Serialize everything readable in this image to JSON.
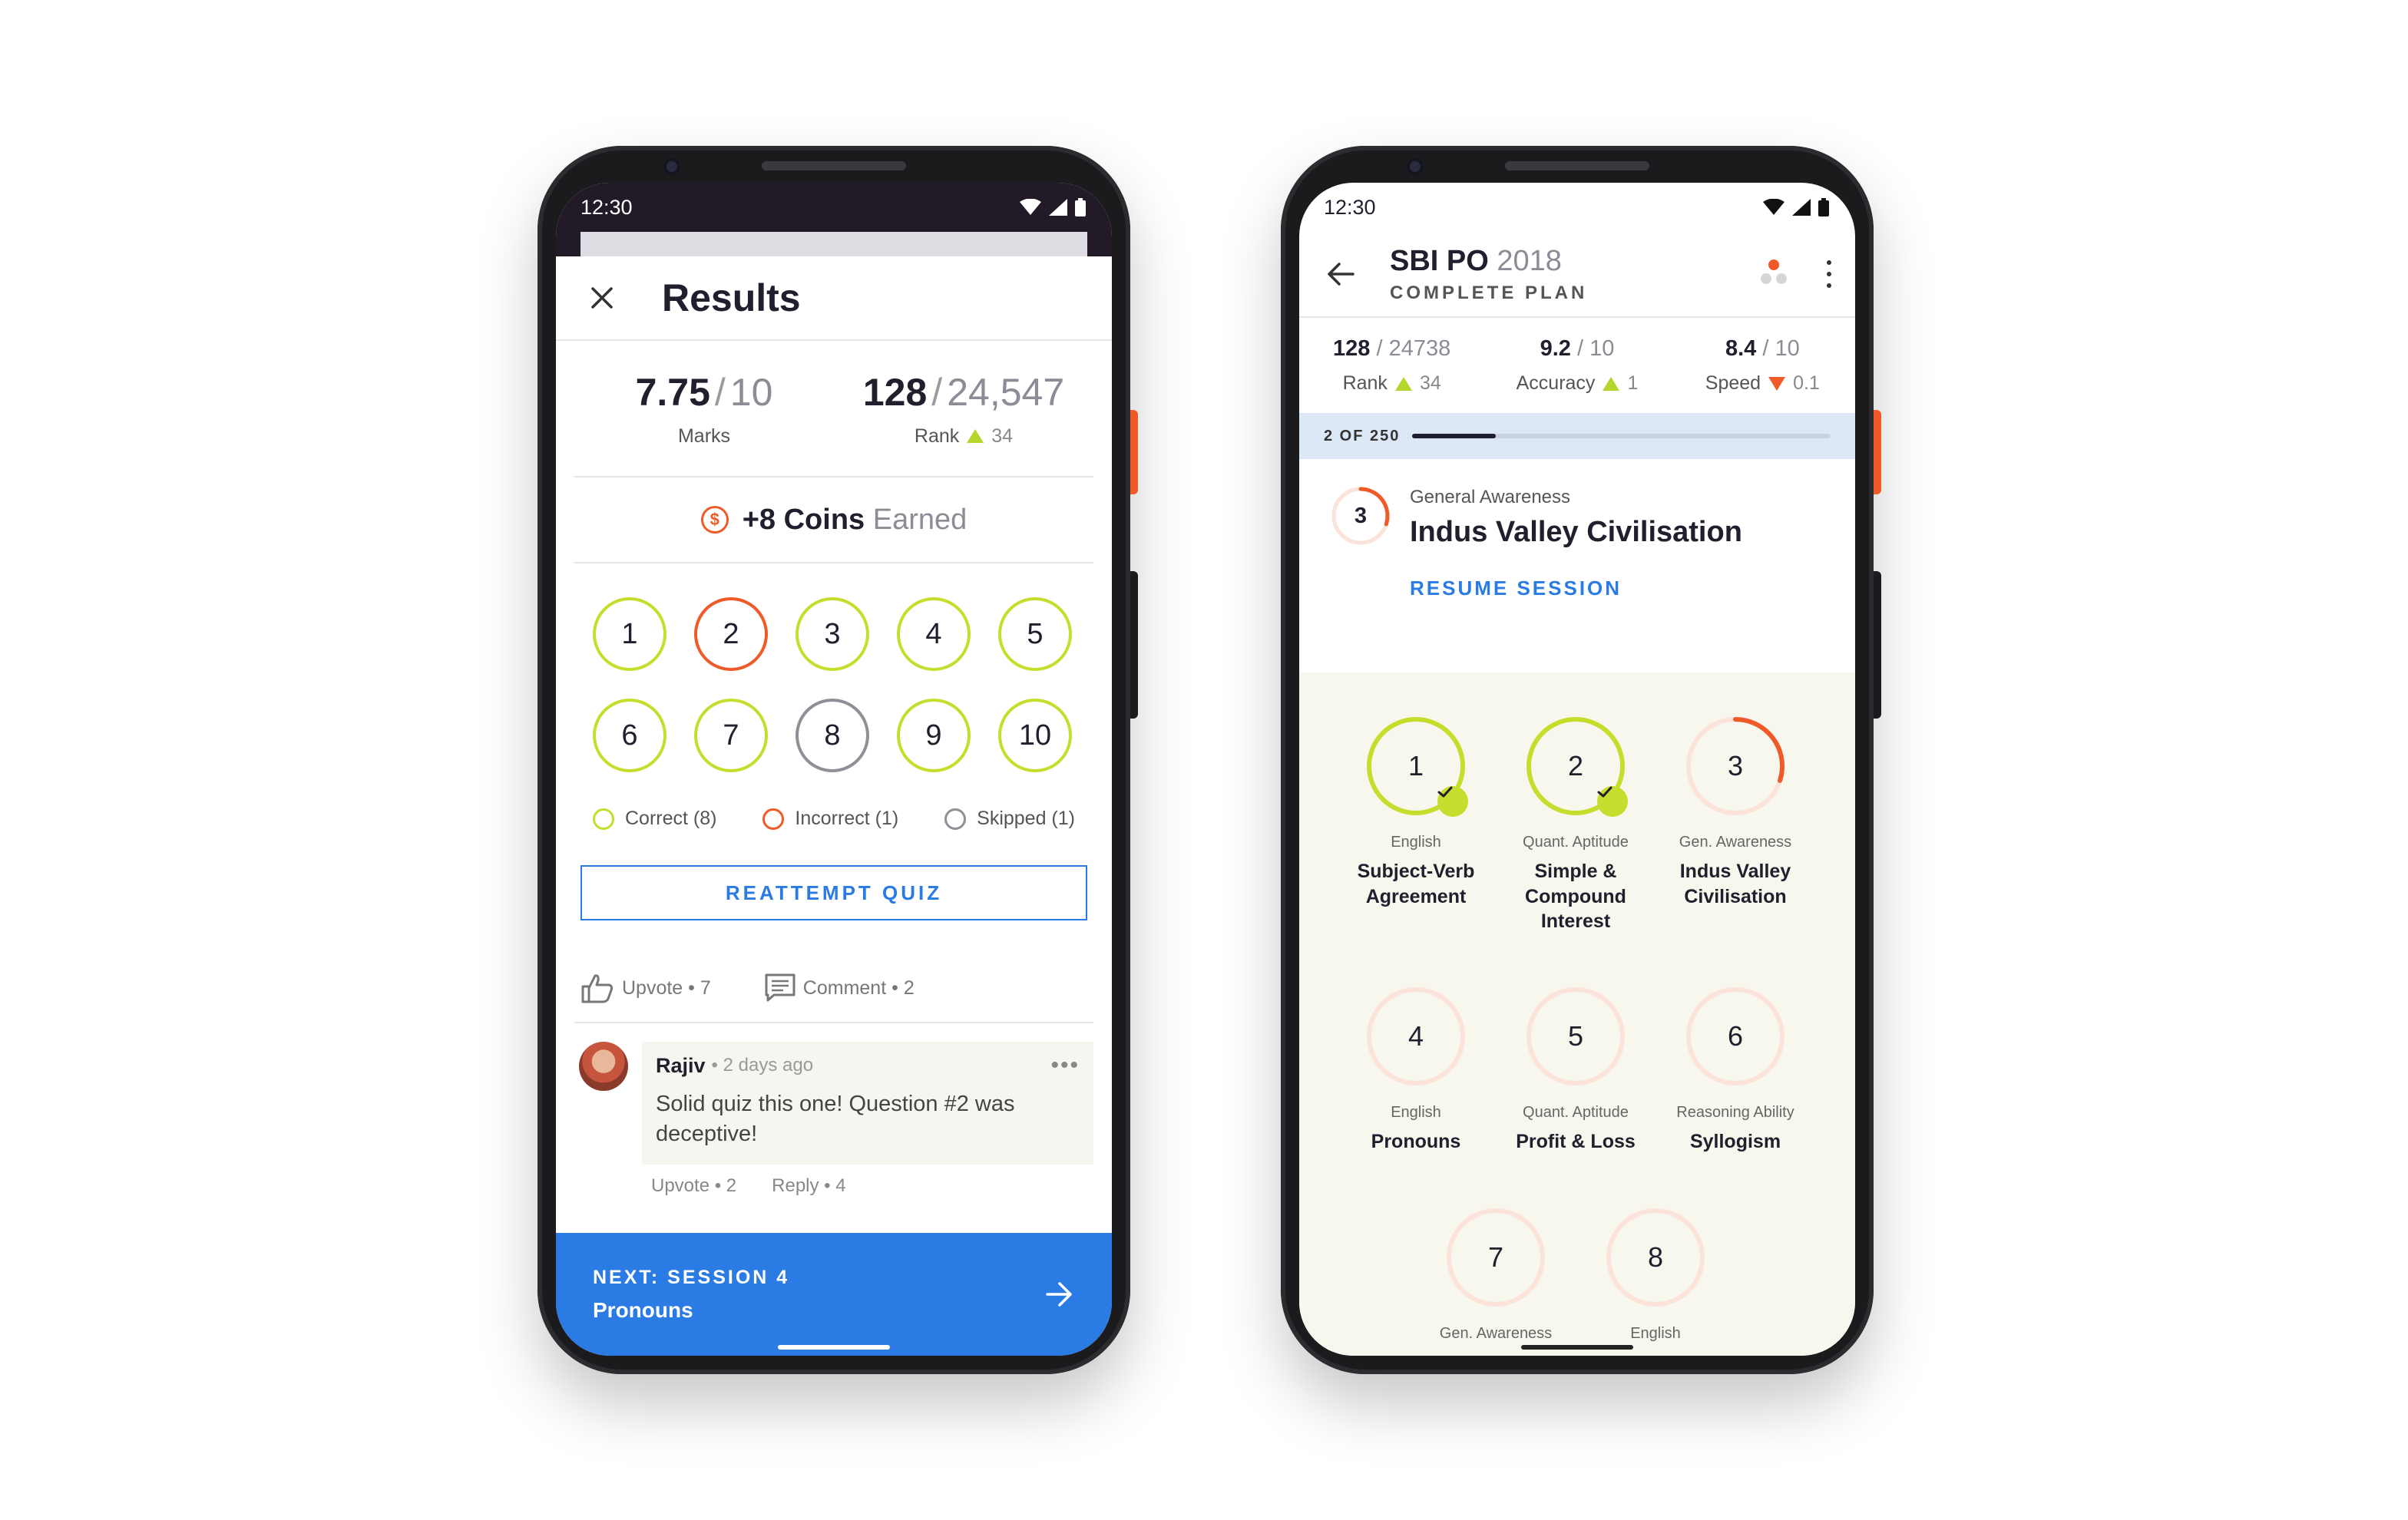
{
  "colors": {
    "correct": "#c6dd2d",
    "incorrect": "#f05a28",
    "skipped": "#8f8f98",
    "accent_blue": "#2a7be4",
    "rise": "#b5d62a",
    "fall": "#f05a28"
  },
  "left_phone": {
    "status": {
      "time": "12:30"
    },
    "header": {
      "title": "Results",
      "close_icon": "close-icon"
    },
    "scores": {
      "marks": {
        "value": "7.75",
        "total": "10",
        "label": "Marks"
      },
      "rank": {
        "value": "128",
        "total": "24,547",
        "label": "Rank",
        "delta": "34",
        "direction": "up"
      }
    },
    "coins": {
      "amount": "+8 Coins",
      "suffix": "Earned",
      "symbol": "$"
    },
    "questions": [
      {
        "n": "1",
        "status": "correct"
      },
      {
        "n": "2",
        "status": "incorrect"
      },
      {
        "n": "3",
        "status": "correct"
      },
      {
        "n": "4",
        "status": "correct"
      },
      {
        "n": "5",
        "status": "correct"
      },
      {
        "n": "6",
        "status": "correct"
      },
      {
        "n": "7",
        "status": "correct"
      },
      {
        "n": "8",
        "status": "skipped"
      },
      {
        "n": "9",
        "status": "correct"
      },
      {
        "n": "10",
        "status": "correct"
      }
    ],
    "legend": {
      "correct": "Correct (8)",
      "incorrect": "Incorrect (1)",
      "skipped": "Skipped (1)"
    },
    "reattempt_label": "REATTEMPT QUIZ",
    "actions": {
      "upvote": "Upvote",
      "upvote_count": "7",
      "comment": "Comment",
      "comment_count": "2"
    },
    "comment": {
      "author": "Rajiv",
      "time": "2 days ago",
      "text": "Solid quiz this one! Question #2 was deceptive!",
      "more": "•••",
      "upvote": "Upvote • 2",
      "reply": "Reply • 4"
    },
    "next": {
      "label": "NEXT: SESSION 4",
      "title": "Pronouns"
    }
  },
  "right_phone": {
    "status": {
      "time": "12:30"
    },
    "header": {
      "title": "SBI PO",
      "year": "2018",
      "subtitle": "COMPLETE PLAN"
    },
    "stats": [
      {
        "value": "128",
        "total": "24738",
        "label": "Rank",
        "delta": "34",
        "direction": "up"
      },
      {
        "value": "9.2",
        "total": "10",
        "label": "Accuracy",
        "delta": "1",
        "direction": "up"
      },
      {
        "value": "8.4",
        "total": "10",
        "label": "Speed",
        "delta": "0.1",
        "direction": "down"
      }
    ],
    "progress": {
      "label": "2 OF 250",
      "current": 2,
      "total": 250
    },
    "current": {
      "number": "3",
      "topic": "General Awareness",
      "title": "Indus Valley Civilisation",
      "resume": "RESUME SESSION",
      "progress": 0.3
    },
    "sessions": [
      {
        "n": "1",
        "subject": "English",
        "title": "Subject-Verb Agreement",
        "state": "done"
      },
      {
        "n": "2",
        "subject": "Quant. Aptitude",
        "title": "Simple & Compound Interest",
        "state": "done"
      },
      {
        "n": "3",
        "subject": "Gen. Awareness",
        "title": "Indus Valley Civilisation",
        "state": "current",
        "progress": 0.3
      },
      {
        "n": "4",
        "subject": "English",
        "title": "Pronouns",
        "state": "todo"
      },
      {
        "n": "5",
        "subject": "Quant. Aptitude",
        "title": "Profit & Loss",
        "state": "todo"
      },
      {
        "n": "6",
        "subject": "Reasoning Ability",
        "title": "Syllogism",
        "state": "todo"
      },
      {
        "n": "7",
        "subject": "Gen. Awareness",
        "title": "",
        "state": "todo"
      },
      {
        "n": "8",
        "subject": "English",
        "title": "",
        "state": "todo"
      }
    ]
  }
}
